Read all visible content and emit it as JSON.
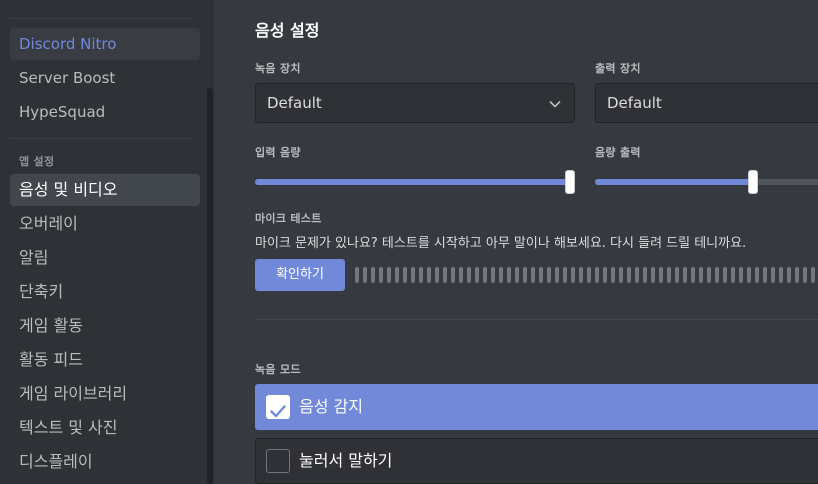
{
  "sidebar": {
    "items_top": [
      {
        "label": "Discord Nitro",
        "kind": "nitro"
      },
      {
        "label": "Server Boost"
      },
      {
        "label": "HypeSquad"
      }
    ],
    "app_settings_header": "앱 설정",
    "app_items": [
      {
        "label": "음성 및 비디오",
        "selected": true
      },
      {
        "label": "오버레이"
      },
      {
        "label": "알림"
      },
      {
        "label": "단축키"
      },
      {
        "label": "게임 활동"
      },
      {
        "label": "활동 피드"
      },
      {
        "label": "게임 라이브러리"
      },
      {
        "label": "텍스트 및 사진"
      },
      {
        "label": "디스플레이"
      }
    ]
  },
  "main": {
    "title": "음성 설정",
    "input_device": {
      "label": "녹음 장치",
      "value": "Default"
    },
    "output_device": {
      "label": "출력 장치",
      "value": "Default"
    },
    "input_volume": {
      "label": "입력 음량",
      "percent": 100
    },
    "output_volume": {
      "label": "음량 출력",
      "percent": 71
    },
    "mic_test": {
      "label": "마이크 테스트",
      "description": "마이크 문제가 있나요? 테스트를 시작하고 아무 말이나 해보세요. 다시 들려 드릴 테니까요.",
      "button": "확인하기"
    },
    "input_mode": {
      "label": "녹음 모드",
      "options": [
        {
          "label": "음성 감지",
          "checked": true
        },
        {
          "label": "눌러서 말하기",
          "checked": false
        }
      ]
    }
  },
  "colors": {
    "accent": "#7289da",
    "background": "#36393f",
    "sidebar": "#2f3136"
  }
}
